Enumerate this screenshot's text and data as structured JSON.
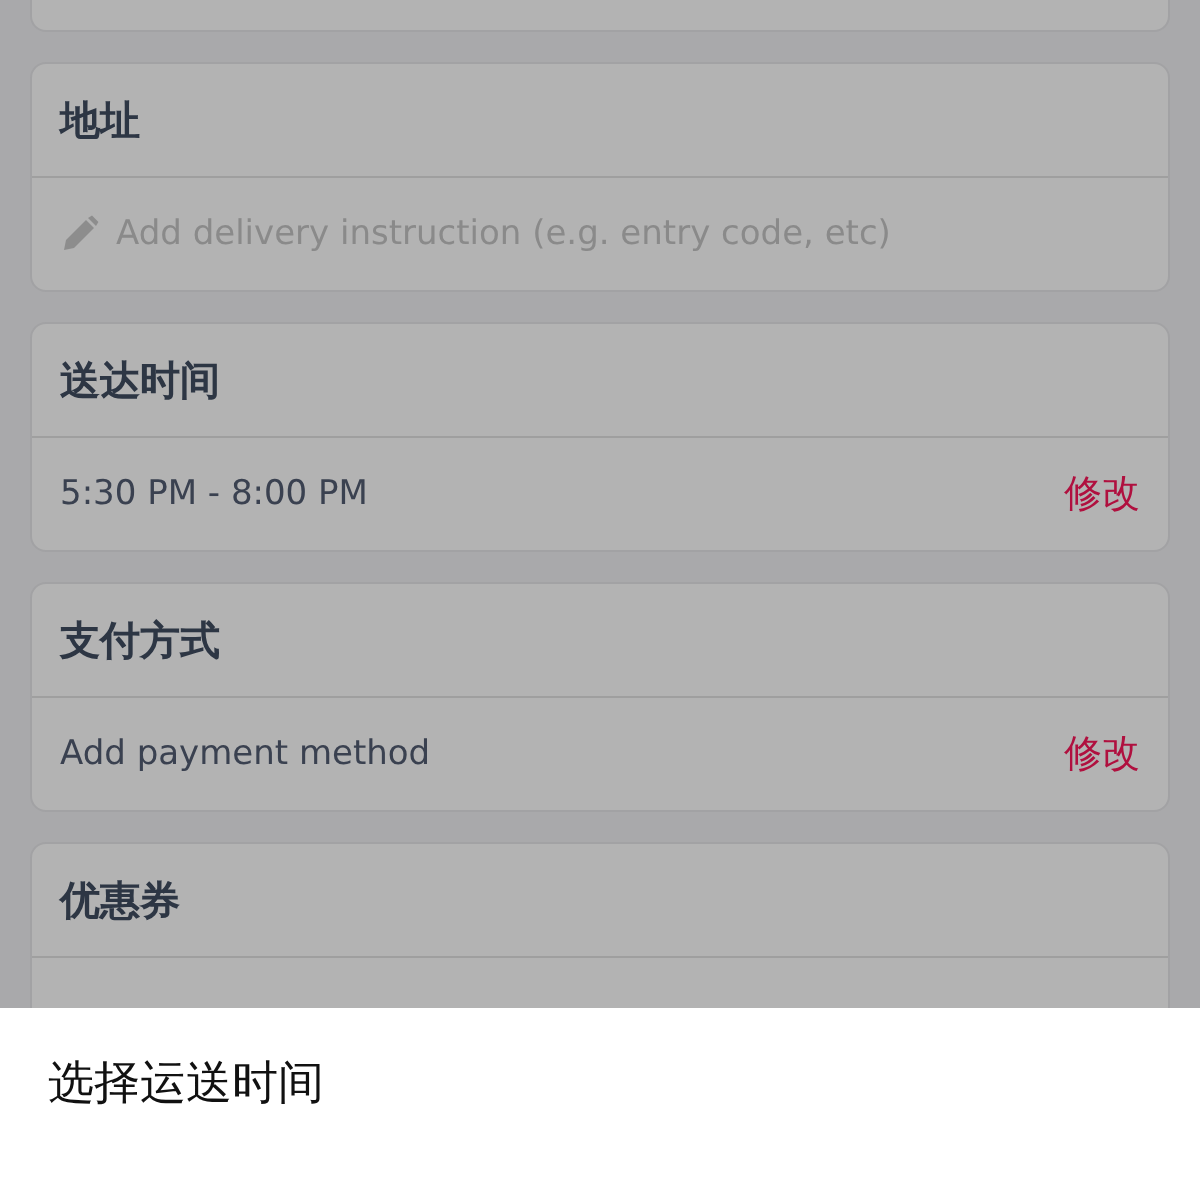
{
  "sections": [
    {
      "kind": "instruction",
      "title": "地址",
      "placeholder": "Add delivery instruction (e.g. entry code, etc)"
    },
    {
      "kind": "value",
      "title": "送达时间",
      "value": "5:30 PM - 8:00 PM",
      "action": "修改"
    },
    {
      "kind": "value",
      "title": "支付方式",
      "value": "Add payment method",
      "action": "修改"
    },
    {
      "kind": "covered",
      "title": "优惠券"
    }
  ],
  "sheet": {
    "title": "选择运送时间"
  }
}
